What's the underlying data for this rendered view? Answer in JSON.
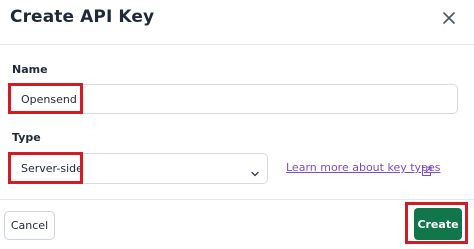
{
  "dialog": {
    "title": "Create API Key",
    "close_icon": "close-icon"
  },
  "form": {
    "name_label": "Name",
    "name_value": "Opensend",
    "type_label": "Type",
    "type_value": "Server-side",
    "type_chevron_icon": "chevron-down-icon",
    "learn_more_text": "Learn more about key types",
    "learn_more_icon": "external-link-icon"
  },
  "footer": {
    "cancel_label": "Cancel",
    "create_label": "Create"
  },
  "colors": {
    "primary": "#11764a",
    "link": "#7c4dbd",
    "highlight": "#d31b24",
    "border": "#d7dbe0"
  }
}
